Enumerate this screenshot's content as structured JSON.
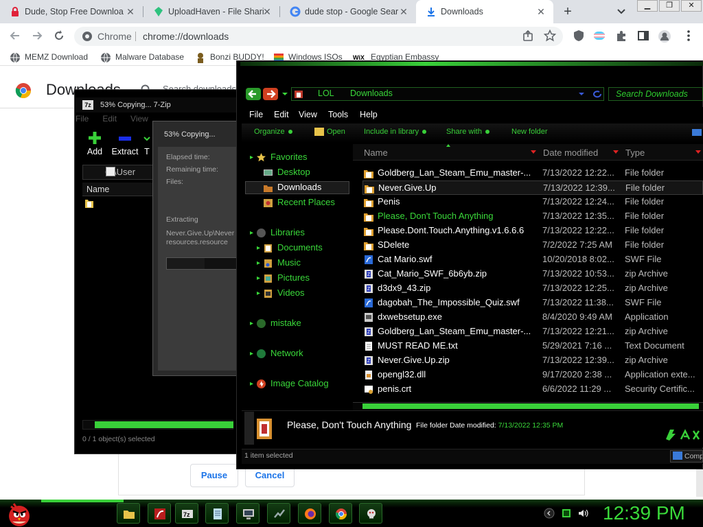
{
  "browser": {
    "tabs": [
      {
        "title": "Dude, Stop Free Downloa",
        "favicon": "red-lock-icon"
      },
      {
        "title": "UploadHaven - File Shari",
        "favicon": "uploadhaven-icon"
      },
      {
        "title": "dude stop - Google Sear",
        "favicon": "google-icon"
      },
      {
        "title": "Downloads",
        "favicon": "download-icon"
      }
    ],
    "new_tab": "+",
    "omnibox_site": "Chrome",
    "omnibox_url": "chrome://downloads",
    "bookmarks": [
      {
        "label": "MEMZ Download",
        "icon": "globe-icon"
      },
      {
        "label": "Malware Database",
        "icon": "globe-icon"
      },
      {
        "label": "Bonzi BUDDY!",
        "icon": "bonzi-icon"
      },
      {
        "label": "Windows ISOs",
        "icon": "windows-flag-icon"
      },
      {
        "label": "Egyptian Embassy",
        "icon": "wix-icon"
      }
    ],
    "wix_badge": "WiX"
  },
  "downloads_page": {
    "title": "Downloads",
    "search_placeholder": "Search downloads",
    "pause_label": "Pause",
    "cancel_label": "Cancel"
  },
  "zip_window": {
    "title": "53% Copying... 7-Zip",
    "menu": [
      "File",
      "Edit",
      "View"
    ],
    "toolbar": [
      "Add",
      "Extract",
      "T"
    ],
    "path": "C:\\User",
    "column_name": "Name",
    "status": "0 / 1 object(s) selected"
  },
  "copy_dialog": {
    "title": "53% Copying...",
    "elapsed_label": "Elapsed time:",
    "remaining_label": "Remaining time:",
    "files_label": "Files:",
    "extracting_label": "Extracting",
    "extracting_path": "Never.Give.Up\\Never",
    "extracting_file": "resources.resource",
    "progress_pct": 53
  },
  "explorer": {
    "breadcrumb": [
      "LOL",
      "Downloads"
    ],
    "search_placeholder": "Search Downloads",
    "menu": [
      "File",
      "Edit",
      "View",
      "Tools",
      "Help"
    ],
    "commands": [
      "Organize",
      "Open",
      "Include in library",
      "Share with",
      "New folder"
    ],
    "nav": {
      "favorites": "Favorites",
      "favorites_items": [
        "Desktop",
        "Downloads",
        "Recent Places"
      ],
      "libraries": "Libraries",
      "libraries_items": [
        "Documents",
        "Music",
        "Pictures",
        "Videos"
      ],
      "mistake": "mistake",
      "network": "Network",
      "image_catalog": "Image Catalog"
    },
    "columns": [
      "Name",
      "Date modified",
      "Type"
    ],
    "files": [
      {
        "name": "Goldberg_Lan_Steam_Emu_master-...",
        "date": "7/13/2022 12:22...",
        "type": "File folder",
        "icon": "folder"
      },
      {
        "name": "Never.Give.Up",
        "date": "7/13/2022 12:39...",
        "type": "File folder",
        "icon": "folder"
      },
      {
        "name": "Penis",
        "date": "7/13/2022 12:24...",
        "type": "File folder",
        "icon": "folder"
      },
      {
        "name": "Please, Don't Touch Anything",
        "date": "7/13/2022 12:35...",
        "type": "File folder",
        "icon": "folder"
      },
      {
        "name": "Please.Dont.Touch.Anything.v1.6.6.6",
        "date": "7/13/2022 12:22...",
        "type": "File folder",
        "icon": "folder"
      },
      {
        "name": "SDelete",
        "date": "7/2/2022 7:25 AM",
        "type": "File folder",
        "icon": "folder"
      },
      {
        "name": "Cat Mario.swf",
        "date": "10/20/2018 8:02...",
        "type": "SWF File",
        "icon": "swf"
      },
      {
        "name": "Cat_Mario_SWF_6b6yb.zip",
        "date": "7/13/2022 10:53...",
        "type": "zip Archive",
        "icon": "zip"
      },
      {
        "name": "d3dx9_43.zip",
        "date": "7/13/2022 12:25...",
        "type": "zip Archive",
        "icon": "zip"
      },
      {
        "name": "dagobah_The_Impossible_Quiz.swf",
        "date": "7/13/2022 11:38...",
        "type": "SWF File",
        "icon": "swf"
      },
      {
        "name": "dxwebsetup.exe",
        "date": "8/4/2020 9:49 AM",
        "type": "Application",
        "icon": "exe"
      },
      {
        "name": "Goldberg_Lan_Steam_Emu_master-...",
        "date": "7/13/2022 12:21...",
        "type": "zip Archive",
        "icon": "zip"
      },
      {
        "name": "MUST READ ME.txt",
        "date": "5/29/2021 7:16 ...",
        "type": "Text Document",
        "icon": "txt"
      },
      {
        "name": "Never.Give.Up.zip",
        "date": "7/13/2022 12:39...",
        "type": "zip Archive",
        "icon": "zip"
      },
      {
        "name": "opengl32.dll",
        "date": "9/17/2020 2:38 ...",
        "type": "Application exte...",
        "icon": "dll"
      },
      {
        "name": "penis.crt",
        "date": "6/6/2022 11:29 ...",
        "type": "Security Certific...",
        "icon": "crt"
      }
    ],
    "selected_index": 1,
    "hover_index": 3,
    "details_name": "Please, Don't Touch Anything",
    "details_meta_label": "File folder  Date modified:",
    "details_meta_value": "7/13/2022 12:35 PM",
    "status": "1 item selected",
    "computer_label": "Comp"
  },
  "taskbar": {
    "clock": "12:39 PM",
    "apps": [
      "explorer-icon",
      "flash-icon",
      "7zip-icon",
      "notepad-icon",
      "computer-icon",
      "winamp-icon",
      "firefox-icon",
      "chrome-icon",
      "dlls-icon"
    ]
  },
  "colors": {
    "accent": "#3ad83a",
    "chrome_blue": "#1a73e8"
  }
}
